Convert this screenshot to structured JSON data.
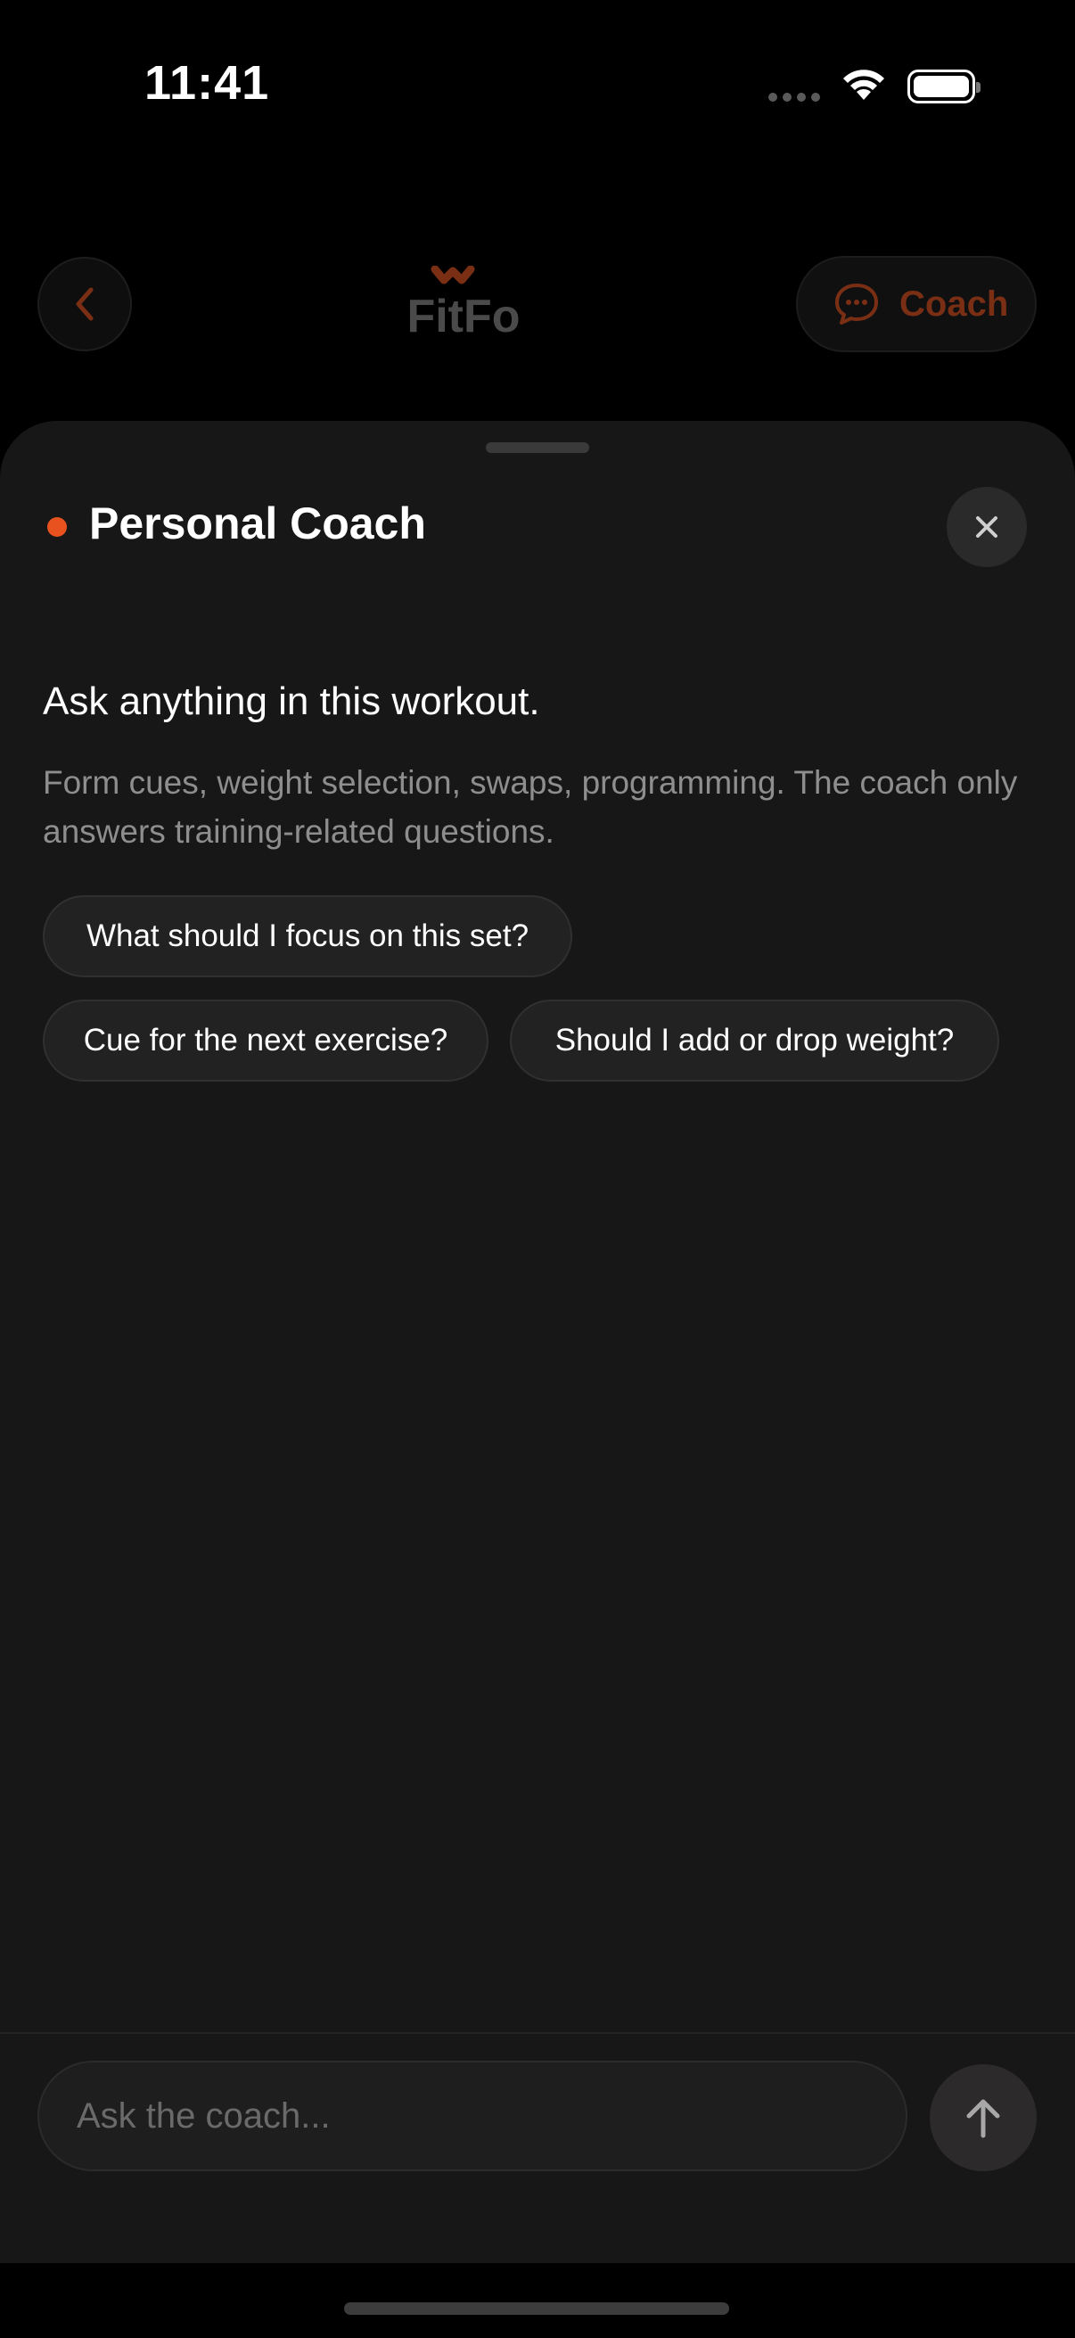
{
  "status_bar": {
    "time": "11:41"
  },
  "nav": {
    "logo_text": "FitFo",
    "coach_button_label": "Coach",
    "icons": {
      "back": "chevron-left-icon",
      "coach": "chat-bubble-icon"
    }
  },
  "sheet": {
    "title": "Personal Coach",
    "close_icon": "close-icon",
    "intro_heading": "Ask anything in this workout.",
    "intro_text": "Form cues, weight selection, swaps, programming. The coach only answers training-related questions.",
    "suggestions": [
      "What should I focus on this set?",
      "Cue for the next exercise?",
      "Should I add or drop weight?"
    ]
  },
  "composer": {
    "placeholder": "Ask the coach...",
    "value": "",
    "send_icon": "arrow-up-icon"
  },
  "colors": {
    "accent": "#e8521f",
    "accent_dim": "#7a2f15",
    "sheet_bg": "#171717",
    "chip_bg": "#222222"
  }
}
